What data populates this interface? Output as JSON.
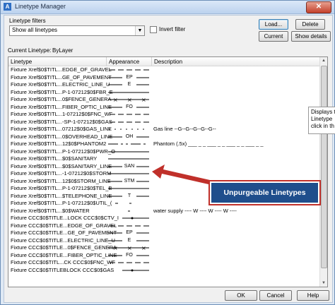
{
  "window": {
    "title": "Linetype Manager",
    "close_symbol": "✕",
    "app_icon": "A"
  },
  "filters": {
    "label": "Linetype filters",
    "selected": "Show all linetypes",
    "invert_label": "Invert filter",
    "invert_checked": false
  },
  "buttons": {
    "load": "Load...",
    "delete": "Delete",
    "current": "Current",
    "show_details": "Show details",
    "ok": "OK",
    "cancel": "Cancel",
    "help": "Help"
  },
  "current_linetype": {
    "label": "Current Linetype:",
    "value": "ByLayer"
  },
  "columns": {
    "linetype": "Linetype",
    "appearance": "Appearance",
    "description": "Description"
  },
  "rows": [
    {
      "name": "Fixture Xref$0$TITL...EDGE_OF_GRAVEL",
      "pattern": "dash",
      "text": "",
      "desc": ""
    },
    {
      "name": "Fixture Xref$0$TITL...GE_OF_PAVEMENT",
      "pattern": "text",
      "text": "EP",
      "desc": ""
    },
    {
      "name": "Fixture Xref$0$TITL...ELECTRIC_LINE_U",
      "pattern": "text",
      "text": "E",
      "desc": ""
    },
    {
      "name": "Fixture Xref$0$TITL...P-1-07212$0$FBR_E",
      "pattern": "solid",
      "text": "",
      "desc": ""
    },
    {
      "name": "Fixture Xref$0$TITL...0$FENCE_GENERA",
      "pattern": "x",
      "text": "",
      "desc": ""
    },
    {
      "name": "Fixture Xref$0$TITL...FIBER_OPTIC_LINE",
      "pattern": "text",
      "text": "FO",
      "desc": ""
    },
    {
      "name": "Fixture Xref$0$TITL...1-07212$0$FNC_WF",
      "pattern": "dash",
      "text": "",
      "desc": ""
    },
    {
      "name": "Fixture Xref$0$TITL...-SP-1-07212$0$GAS",
      "pattern": "dash",
      "text": "",
      "desc": ""
    },
    {
      "name": "Fixture Xref$0$TITL...07212$0$GAS_LINE",
      "pattern": "dots",
      "text": "",
      "desc": "Gas line --G--G--G--G--G--"
    },
    {
      "name": "Fixture Xref$0$TITL...0$OVERHEAD_LINE",
      "pattern": "text",
      "text": "OH",
      "desc": ""
    },
    {
      "name": "Fixture Xref$0$TITL...12$0$PHANTOM2",
      "pattern": "phantom",
      "text": "",
      "desc": "Phantom (.5x) ___ _ _ ___ _ _ ___ _ _ ___ _ _"
    },
    {
      "name": "Fixture Xref$0$TITL...P-1-07212$0$PWR_O",
      "pattern": "solid",
      "text": "",
      "desc": ""
    },
    {
      "name": "Fixture Xref$0$TITL...$0$SANITARY",
      "pattern": "solid",
      "text": "",
      "desc": ""
    },
    {
      "name": "Fixture Xref$0$TITL...$0$SANITARY_LINE",
      "pattern": "text",
      "text": "SAN",
      "desc": ""
    },
    {
      "name": "Fixture Xref$0$TITL...-1-07212$0$STORM",
      "pattern": "solid",
      "text": "",
      "desc": ""
    },
    {
      "name": "Fixture Xref$0$TITL...12$0$STORM_LINE",
      "pattern": "text",
      "text": "STM",
      "desc": ""
    },
    {
      "name": "Fixture Xref$0$TITL...P-1-07212$0$TEL_B",
      "pattern": "solid",
      "text": "",
      "desc": ""
    },
    {
      "name": "Fixture Xref$0$TITL...$TELEPHONE_LINE",
      "pattern": "text",
      "text": "T",
      "desc": ""
    },
    {
      "name": "Fixture Xref$0$TITL...P-1-07212$0$UTIL_(",
      "pattern": "dotsmall",
      "text": "",
      "desc": ""
    },
    {
      "name": "Fixture Xref$0$TITL...$0$WATER",
      "pattern": "dotcenter",
      "text": "",
      "desc": "water supply ---- W ---- W ---- W ----"
    },
    {
      "name": "Fixture CCC$0$TITLE...LOCK CCC$0$CTV_I",
      "pattern": "solidmark",
      "text": "",
      "desc": ""
    },
    {
      "name": "Fixture CCC$0$TITLE...EDGE_OF_GRAVEL",
      "pattern": "dash",
      "text": "",
      "desc": ""
    },
    {
      "name": "Fixture CCC$0$TITLE...GE_OF_PAVEMENT",
      "pattern": "text",
      "text": "EP",
      "desc": ""
    },
    {
      "name": "Fixture CCC$0$TITLE...ELECTRIC_LINE_U",
      "pattern": "text",
      "text": "E",
      "desc": ""
    },
    {
      "name": "Fixture CCC$0$TITLE...0$FENCE_GENERA",
      "pattern": "x",
      "text": "",
      "desc": ""
    },
    {
      "name": "Fixture CCC$0$TITLE...FIBER_OPTIC_LINE",
      "pattern": "text",
      "text": "FO",
      "desc": ""
    },
    {
      "name": "Fixture CCC$0$TITL...CK CCC$0$FNC_WF",
      "pattern": "dash",
      "text": "",
      "desc": ""
    },
    {
      "name": "Fixture CCC$0$TITLEBLOCK CCC$0$GAS",
      "pattern": "solidmark",
      "text": "",
      "desc": ""
    }
  ],
  "tooltip": {
    "lines": [
      "Displays t",
      "Linetype",
      "click in th"
    ]
  },
  "callout": {
    "text": "Unpurgeable Linetypes",
    "bg": "#1f4e8c",
    "border": "#c0302a"
  },
  "colors": {
    "selection": "#3399ff",
    "arrow": "#c0302a"
  }
}
